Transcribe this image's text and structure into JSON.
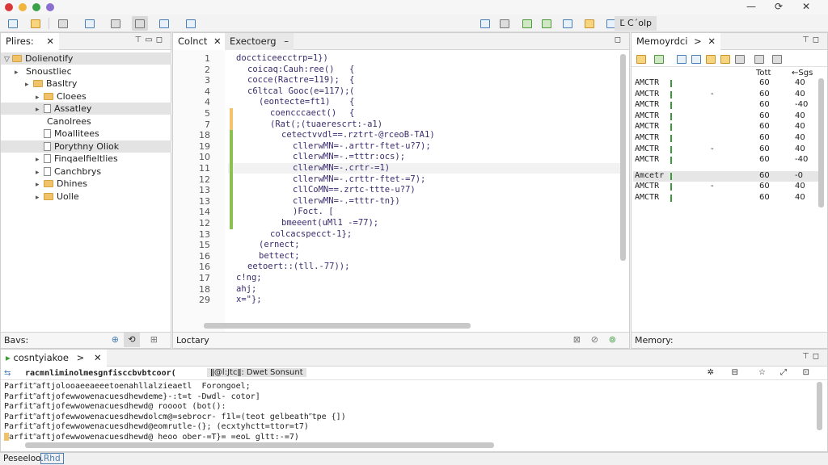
{
  "toolbar": {
    "quick_access": "Ľ Cˊolp",
    "window_controls": [
      "—",
      "⟳",
      "✕"
    ]
  },
  "files": {
    "tab": "Plires:",
    "items": [
      {
        "twisty": "▽",
        "icon": "folder",
        "label": "Dolienotify",
        "indent": 0,
        "selected": true
      },
      {
        "twisty": "▸",
        "icon": "none",
        "label": "Snoustliec",
        "indent": 1
      },
      {
        "twisty": "▸",
        "icon": "folder",
        "label": "Basltry",
        "indent": 2
      },
      {
        "twisty": "▸",
        "icon": "folder",
        "label": "Cloees",
        "indent": 3
      },
      {
        "twisty": "▸",
        "icon": "file",
        "label": "Assatley",
        "indent": 3,
        "selected": true
      },
      {
        "twisty": "",
        "icon": "none",
        "label": "Canolrees",
        "indent": 3
      },
      {
        "twisty": "",
        "icon": "file",
        "label": "Moallitees",
        "indent": 3
      },
      {
        "twisty": "",
        "icon": "file",
        "label": "Porythny Oliok",
        "indent": 3,
        "selected": true
      },
      {
        "twisty": "▸",
        "icon": "file",
        "label": "Finqaelfieltlies",
        "indent": 3
      },
      {
        "twisty": "▸",
        "icon": "file",
        "label": "Canchbrys",
        "indent": 3
      },
      {
        "twisty": "▸",
        "icon": "folder",
        "label": "Dhines",
        "indent": 3
      },
      {
        "twisty": "▸",
        "icon": "folder",
        "label": "Uolle",
        "indent": 3
      }
    ],
    "footer_label": "Bavs:"
  },
  "editor": {
    "tabs": [
      "Colnct",
      "Exectoerg"
    ],
    "footer_label": "Loctary",
    "lines": [
      {
        "n": "1",
        "indent": 0,
        "text": "doccticeecctrp=1})"
      },
      {
        "n": "2",
        "indent": 1,
        "text": "coicaq:Cauh:ree()"
      },
      {
        "n": "3",
        "indent": 1,
        "text": "cocce(Ractre=119);"
      },
      {
        "n": "4",
        "indent": 1,
        "text": "c6ltcal Gooc(e=117);"
      },
      {
        "n": "4",
        "indent": 2,
        "text": "(eontecte=ft1)"
      },
      {
        "n": "5",
        "indent": 3,
        "text": "coencccaect()"
      },
      {
        "n": "7",
        "indent": 3,
        "text": "(Rat(;(tuaerescrt:-a1)"
      },
      {
        "n": "18",
        "indent": 4,
        "text": "cetectvvdl==.rztrt-@rceoB-TA1)"
      },
      {
        "n": "19",
        "indent": 5,
        "text": "cllerwMN=-.arttr-ftet-u?7);"
      },
      {
        "n": "10",
        "indent": 5,
        "text": "cllerwMN=-.=tttr:ocs);"
      },
      {
        "n": "11",
        "indent": 5,
        "text": "cllerwMN=-.crtr-=1)"
      },
      {
        "n": "12",
        "indent": 5,
        "text": "cllerwMN=-.crttr-ftet-=7);"
      },
      {
        "n": "13",
        "indent": 5,
        "text": "cllCoMN==.zrtc-ttte-u?7)"
      },
      {
        "n": "13",
        "indent": 5,
        "text": "cllerwMN=-.=tttr-tn})"
      },
      {
        "n": "14",
        "indent": 5,
        "text": ")Foct. ["
      },
      {
        "n": "12",
        "indent": 4,
        "text": "bmeeent(uMl1 -=77);"
      },
      {
        "n": "13",
        "indent": 3,
        "text": "colcacspecct-1};"
      },
      {
        "n": "15",
        "indent": 2,
        "text": "(ernect;"
      },
      {
        "n": "16",
        "indent": 2,
        "text": "bettect;"
      },
      {
        "n": "16",
        "indent": 1,
        "text": "eetoert::(tll.-77));"
      },
      {
        "n": "17",
        "indent": 0,
        "text": "c!ng;"
      },
      {
        "n": "18",
        "indent": 0,
        "text": "ahj;"
      },
      {
        "n": "29",
        "indent": 0,
        "text": "x=\"};"
      }
    ],
    "brace_marks": [
      "{",
      "{",
      "(",
      "{",
      "{"
    ]
  },
  "memory": {
    "tab": "Memoyrdci",
    "header": [
      "Tott",
      "←Sgs"
    ],
    "footer_label": "Memory:",
    "rows": [
      {
        "name": "AMCTR",
        "dash": "",
        "v": "60",
        "n": "40"
      },
      {
        "name": "AMCTR",
        "dash": "-",
        "v": "60",
        "n": "40"
      },
      {
        "name": "AMCTR",
        "dash": "",
        "v": "60",
        "n": "-40"
      },
      {
        "name": "AMCTR",
        "dash": "",
        "v": "60",
        "n": "40"
      },
      {
        "name": "AMCTR",
        "dash": "",
        "v": "60",
        "n": "40"
      },
      {
        "name": "AMCTR",
        "dash": "",
        "v": "60",
        "n": "40"
      },
      {
        "name": "AMCTR",
        "dash": "-",
        "v": "60",
        "n": "40"
      },
      {
        "name": "AMCTR",
        "dash": "",
        "v": "60",
        "n": "-40"
      },
      {
        "name": "Amcetr",
        "dash": "",
        "v": "60",
        "n": "-0"
      },
      {
        "name": "AMCTR",
        "dash": "-",
        "v": "60",
        "n": "40"
      },
      {
        "name": "AMCTR",
        "dash": "",
        "v": "60",
        "n": "40"
      }
    ]
  },
  "console": {
    "tab": "cosntyiakoe",
    "header": "racmnliminolmesgnfisccbvbtcoor(",
    "header_right": "ǁ@l:Jtcǁ: Dwet Sonsunt",
    "rows": [
      "Parfitʺaftjolooaeeaeeetoenahllalzieaetl  Forongoel;",
      "Parfitʺaftjofewwowenacuesdhewdeme}-:t=t -Dwdl- cotor]",
      "Parfitʺaftjofewwowenacuesdhewd@ roooot (bot():",
      "Parfitʺaftjofewwowenacuesdhewdolcm@=sebrocr- f1l=(teot gelbeathʺtpe {])",
      "Parfitʺaftjofewwowenacuesdhewd@eomrutle-(}; (ecxtyhctt=ttor=t7)",
      "Parfitʺaftjofewwowenacuesdhewd@ heoo ober-=T}= =eoL gltt:-=7)"
    ]
  },
  "status": {
    "left": "Peseeloo.",
    "right": "Rhd"
  },
  "colors": {
    "accent_blue": "#4a7fb5",
    "folder": "#f0c36b",
    "change_bar": "#8cc152",
    "change_orange": "#f5c36b",
    "ok_green": "#3a9b3a"
  }
}
